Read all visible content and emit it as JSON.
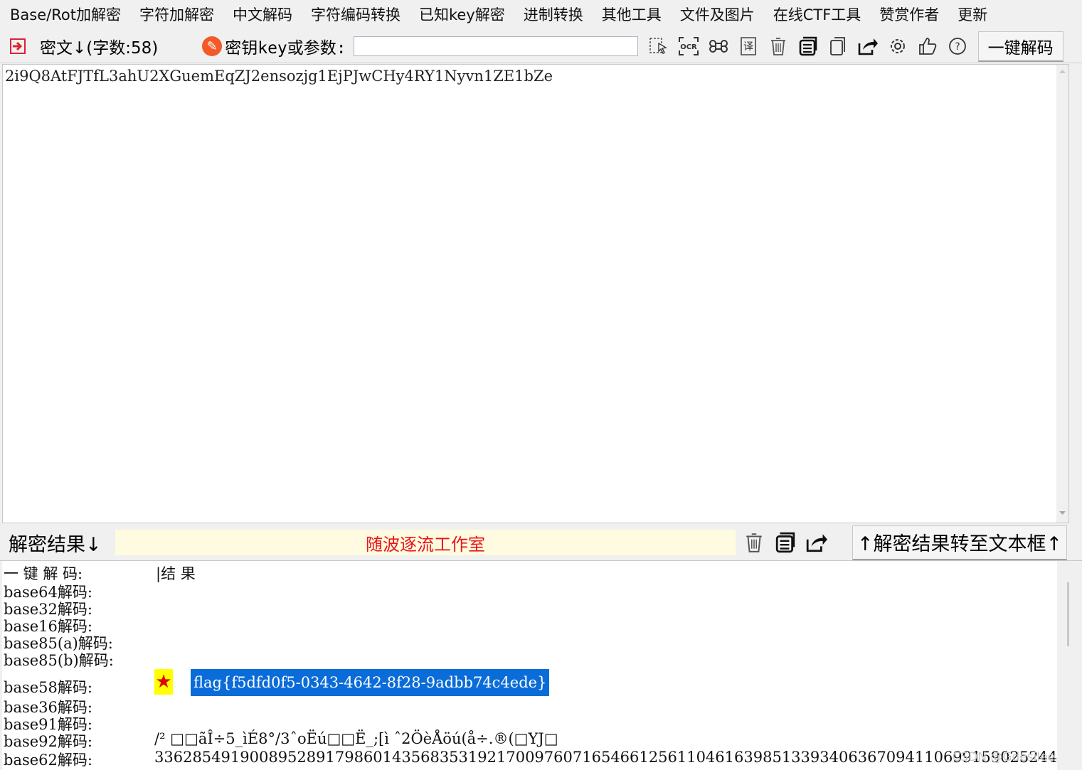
{
  "menu": [
    "Base/Rot加解密",
    "字符加解密",
    "中文解码",
    "字符编码转换",
    "已知key解密",
    "进制转换",
    "其他工具",
    "文件及图片",
    "在线CTF工具",
    "赞赏作者",
    "更新"
  ],
  "toolbar": {
    "cipher_label": "密文↓(字数:58)",
    "key_label": "密钥key或参数:",
    "key_value": "",
    "onekey_label": "一键解码"
  },
  "cipher_text": "2i9Q8AtFJTfL3ahU2XGuemEqZJ2ensozjg1EjPJwCHy4RY1Nyvn1ZE1bZe",
  "result_bar": {
    "label": "解密结果↓",
    "studio": "随波逐流工作室",
    "to_textbox": "↑解密结果转至文本框↑"
  },
  "results": {
    "header_label": "一 键 解 码:",
    "header_result": "|结    果",
    "rows": [
      {
        "label": "base64解码:",
        "value": ""
      },
      {
        "label": "base32解码:",
        "value": ""
      },
      {
        "label": "base16解码:",
        "value": ""
      },
      {
        "label": "base85(a)解码:",
        "value": ""
      },
      {
        "label": "base85(b)解码:",
        "value": ""
      },
      {
        "label": "base58解码:",
        "value": "flag{f5dfd0f5-0343-4642-8f28-9adbb74c4ede}"
      },
      {
        "label": "base36解码:",
        "value": ""
      },
      {
        "label": "base91解码:",
        "value": ""
      },
      {
        "label": "base92解码:",
        "value": "/² □□ãÎ÷5_ìÉ8°/3ˆoËú□□Ë_;[ì ˆ2ÖèÅöú(å÷.®(□YJ□"
      },
      {
        "label": "base62解码:",
        "value": "33628549190089528917986014356835319217009760716546612561104616398513393406367094110699159025244"
      }
    ],
    "star": "★"
  },
  "watermark": "CSDN @Gdesilee",
  "colors": {
    "accent_red": "#e8141a",
    "selection_blue": "#0a6cd8",
    "studio_bg": "#fffbe0",
    "star_bg": "#ffff00"
  }
}
